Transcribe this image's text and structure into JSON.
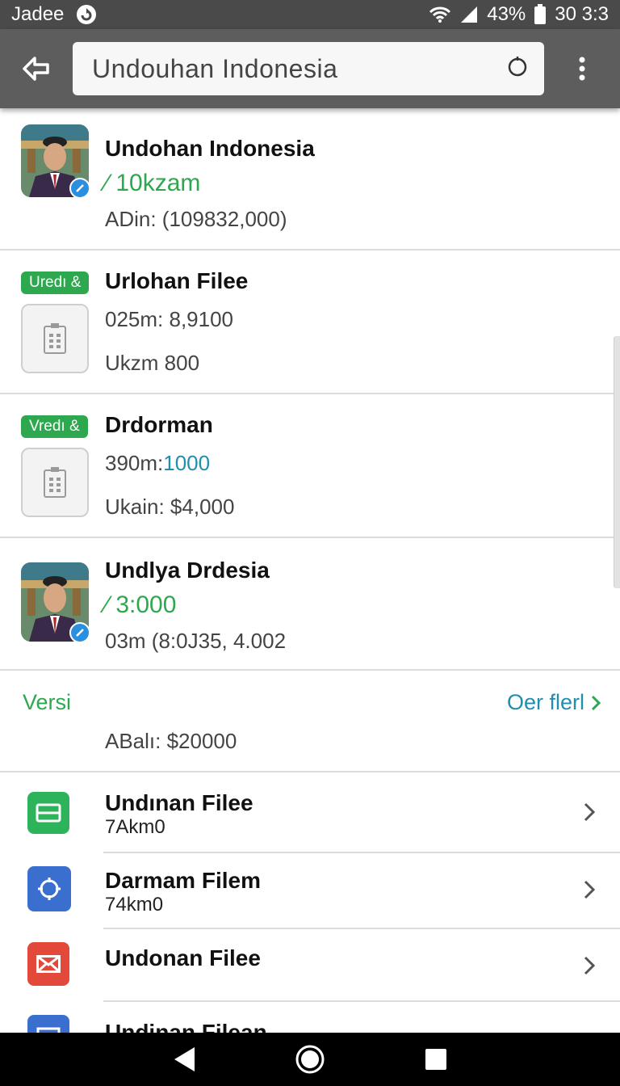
{
  "status_bar": {
    "carrier": "Jadee",
    "battery": "43%",
    "time": "30 3:3"
  },
  "search": {
    "query": "Undouhan Indonesia"
  },
  "results": [
    {
      "title": "Undohan Indonesia",
      "price": "⁄ 10kzam",
      "meta": "ADin: (109832,000)"
    },
    {
      "badge": "Uredı &",
      "title": "Urlohan Filee",
      "line1": "025m: 8,9100",
      "line2": "Ukzm 800"
    },
    {
      "badge": "Vredı &",
      "title": "Drdorman",
      "line1_prefix": "390m:",
      "line1_value": "1000",
      "line2": "Ukain: $4,000"
    },
    {
      "title": "Undlya Drdesia",
      "price": "⁄ 3:000",
      "meta": "03m (8:0J35, 4.002"
    }
  ],
  "section": {
    "label": "Versi",
    "link": "Oer flerl",
    "total": "ABalı:  $20000"
  },
  "files": [
    {
      "title": "Undınan Filee",
      "sub": "7Akm0",
      "icon": "green-card-icon",
      "color": "#2db35a"
    },
    {
      "title": "Darmam Filem",
      "sub": "74km0",
      "icon": "blue-target-icon",
      "color": "#3a6fd0"
    },
    {
      "title": "Undonan Filee",
      "sub": "",
      "icon": "red-mail-icon",
      "color": "#e2493a"
    },
    {
      "title": "Undinan Filean",
      "sub": "",
      "icon": "blue-doc-icon",
      "color": "#3a6fd0"
    }
  ]
}
